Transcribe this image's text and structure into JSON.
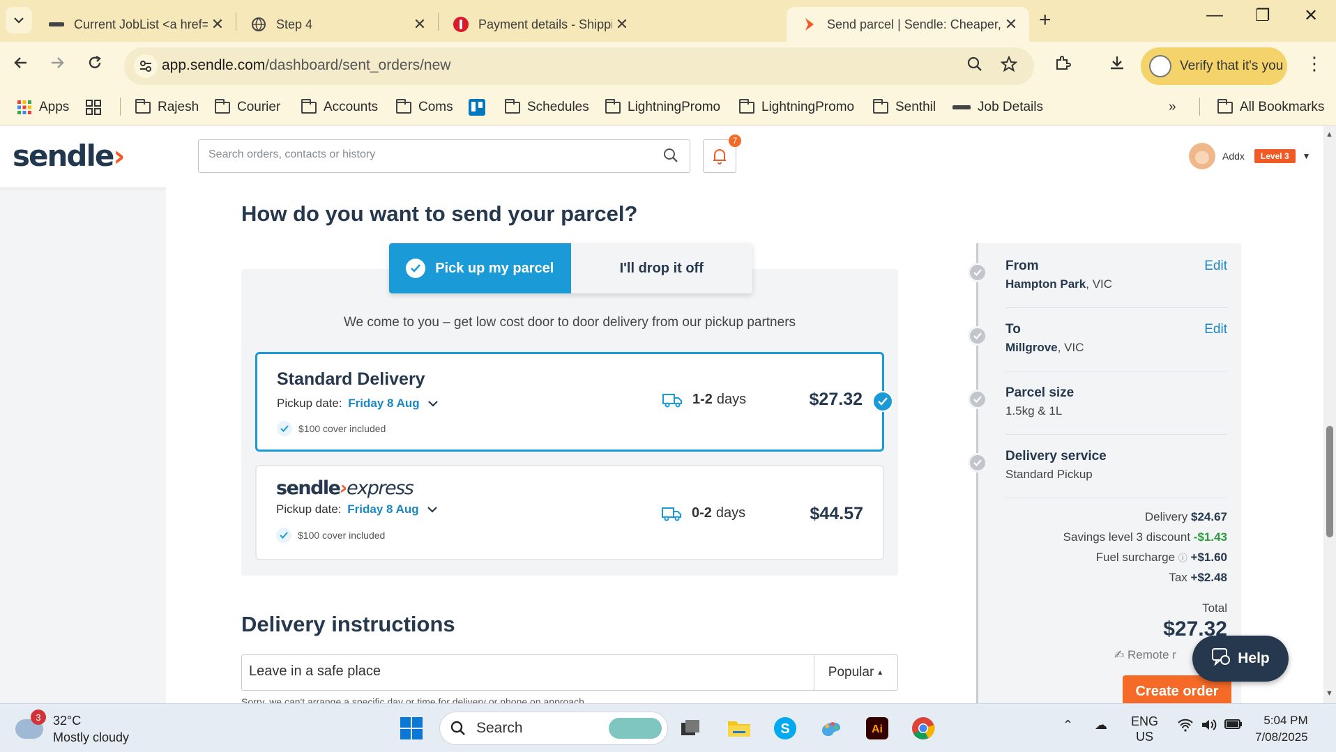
{
  "browser": {
    "tabs": [
      {
        "title": "Current JobList <a href=\"https:/",
        "active": false
      },
      {
        "title": "Step 4",
        "active": false
      },
      {
        "title": "Payment details - Shipping - My",
        "active": false
      },
      {
        "title": "Send parcel | Sendle: Cheaper, s",
        "active": true
      }
    ],
    "url_host": "app.sendle.com",
    "url_path": "/dashboard/sent_orders/new",
    "profile_label": "Verify that it's you",
    "bookmarks": [
      "Apps",
      "Rajesh",
      "Courier",
      "Accounts",
      "Coms",
      "Schedules",
      "LightningPromo",
      "LightningPromo",
      "Senthil",
      "Job Details"
    ],
    "all_bookmarks": "All Bookmarks"
  },
  "header": {
    "logo_text": "sendle",
    "search_placeholder": "Search orders, contacts or history",
    "notifications_count": "7",
    "user_name": "Addx",
    "user_level": "Level 3"
  },
  "main": {
    "question": "How do you want to send your parcel?",
    "mode_options": [
      "Pick up my parcel",
      "I'll drop it off"
    ],
    "mode_selected": "Pick up my parcel",
    "subtitle": "We come to you – get low cost door to door delivery from our pickup partners",
    "options": [
      {
        "title": "Standard Delivery",
        "pickup_label": "Pickup date:",
        "pickup_date": "Friday 8 Aug",
        "cover": "$100 cover included",
        "days_bold": "1-2",
        "days_suffix": "days",
        "price": "$27.32",
        "selected": true
      },
      {
        "title_a": "sendle",
        "title_b": "express",
        "pickup_label": "Pickup date:",
        "pickup_date": "Friday 8 Aug",
        "cover": "$100 cover included",
        "days_bold": "0-2",
        "days_suffix": "days",
        "price": "$44.57",
        "selected": false
      }
    ],
    "delivery_instructions_title": "Delivery instructions",
    "instructions_value": "Leave in a safe place",
    "popular_label": "Popular",
    "note": "Sorry, we can't arrange a specific day or time for delivery or phone on approach."
  },
  "summary": {
    "steps": [
      {
        "label": "From",
        "value_bold": "Hampton Park",
        "value_rest": ", VIC",
        "edit": "Edit"
      },
      {
        "label": "To",
        "value_bold": "Millgrove",
        "value_rest": ", VIC",
        "edit": "Edit"
      },
      {
        "label": "Parcel size",
        "value_bold": "",
        "value_rest": "1.5kg & 1L",
        "edit": ""
      },
      {
        "label": "Delivery service",
        "value_bold": "",
        "value_rest": "Standard Pickup",
        "edit": ""
      }
    ],
    "costs": [
      {
        "label": "Delivery",
        "value": "$24.67"
      },
      {
        "label": "Savings level 3 discount",
        "value": "-$1.43"
      },
      {
        "label": "Fuel surcharge",
        "value": "+$1.60"
      },
      {
        "label": "Tax",
        "value": "+$2.48"
      }
    ],
    "total_label": "Total",
    "total_value": "$27.32",
    "remote_label": "Remote r",
    "create_order": "Create order",
    "help": "Help"
  },
  "taskbar": {
    "weather_temp": "32°C",
    "weather_desc": "Mostly cloudy",
    "weather_badge": "3",
    "search_label": "Search",
    "lang_1": "ENG",
    "lang_2": "US",
    "time": "5:04 PM",
    "date": "7/08/2025"
  },
  "colors": {
    "accent_blue": "#1a9bd7",
    "brand_orange": "#f15a24",
    "navy": "#25384d",
    "discount_green": "#2a9a3a"
  }
}
